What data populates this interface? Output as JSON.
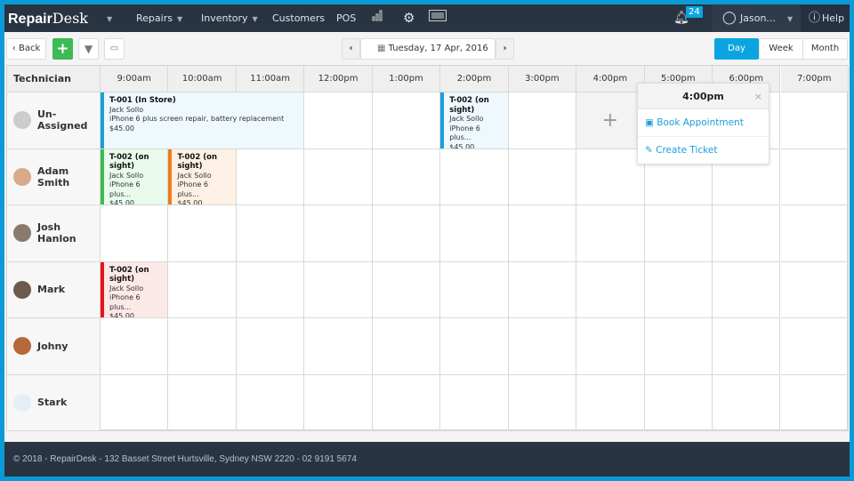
{
  "nav": {
    "logo": "RepairDesk",
    "logo_a": "Repair",
    "logo_b": "Desk",
    "items": [
      "Repairs",
      "Inventory",
      "Customers",
      "POS"
    ],
    "notifications": "24",
    "user": "Jason...",
    "help": "Help"
  },
  "toolbar": {
    "back": "Back",
    "date": "Tuesday, 17 Apr, 2016",
    "views": [
      "Day",
      "Week",
      "Month"
    ],
    "active_view": "Day"
  },
  "colors": {
    "accent": "#0aa5e0",
    "nav_bg": "#283442",
    "green": "#3dba54"
  },
  "grid": {
    "tech_header": "Technician",
    "hours": [
      "9:00am",
      "10:00am",
      "11:00am",
      "12:00pm",
      "1:00pm",
      "2:00pm",
      "3:00pm",
      "4:00pm",
      "5:00pm",
      "6:00pm",
      "7:00pm"
    ],
    "technicians": [
      "Un-Assigned",
      "Adam Smith",
      "Josh Hanlon",
      "Mark",
      "Johny",
      "Stark"
    ],
    "events": [
      {
        "row": 0,
        "start": 0,
        "span": 3,
        "title": "T-001 (In Store)",
        "customer": "Jack Sollo",
        "desc": "iPhone 6 plus screen repair, battery replacement",
        "price": "$45.00",
        "color": "#1a9fd8",
        "bg": "#eef8fd"
      },
      {
        "row": 0,
        "start": 5,
        "span": 1,
        "title": "T-002 (on sight)",
        "customer": "Jack Sollo",
        "desc": "iPhone 6 plus...",
        "price": "$45.00",
        "color": "#1a9fd8",
        "bg": "#eef8fd"
      },
      {
        "row": 1,
        "start": 0,
        "span": 1,
        "title": "T-002 (on sight)",
        "customer": "Jack Sollo",
        "desc": "iPhone 6 plus...",
        "price": "$45.00",
        "color": "#3dba54",
        "bg": "#e9fbec"
      },
      {
        "row": 1,
        "start": 1,
        "span": 1,
        "title": "T-002 (on sight)",
        "customer": "Jack Sollo",
        "desc": "iPhone 6 plus...",
        "price": "$45.00",
        "color": "#f07b1a",
        "bg": "#fdf0e4"
      },
      {
        "row": 3,
        "start": 0,
        "span": 1,
        "title": "T-002 (on sight)",
        "customer": "Jack Sollo",
        "desc": "iPhone 6 plus...",
        "price": "$45.00",
        "color": "#e8131b",
        "bg": "#fde8e8"
      }
    ]
  },
  "popup": {
    "title": "4:00pm",
    "book": "Book Appointment",
    "create": "Create Ticket"
  },
  "footer": "© 2018 - RepairDesk - 132 Basset Street Hurtsville, Sydney NSW 2220 - 02 9191 5674"
}
